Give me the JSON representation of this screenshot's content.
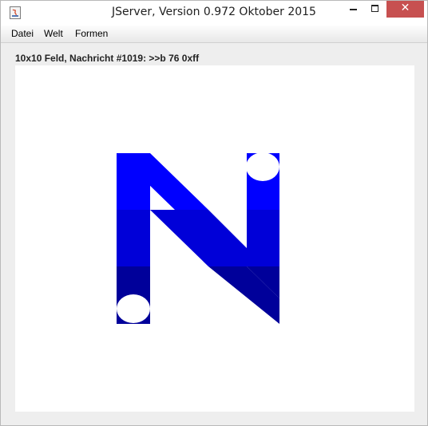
{
  "window": {
    "title": "JServer, Version 0.972 Oktober 2015",
    "controls": {
      "minimize": "minimize-icon",
      "maximize": "maximize-icon",
      "close": "close-icon",
      "close_glyph": "✕"
    }
  },
  "menu": {
    "items": [
      "Datei",
      "Welt",
      "Formen"
    ]
  },
  "status": {
    "text": "10x10 Feld, Nachricht #1019: >>b 76 0xff"
  },
  "board": {
    "size": "10x10",
    "shape": "N",
    "colors": {
      "level1": "#0000ff",
      "level2": "#0000d8",
      "level3": "#00009a",
      "dot": "#ffffff",
      "background": "#ffffff"
    }
  }
}
